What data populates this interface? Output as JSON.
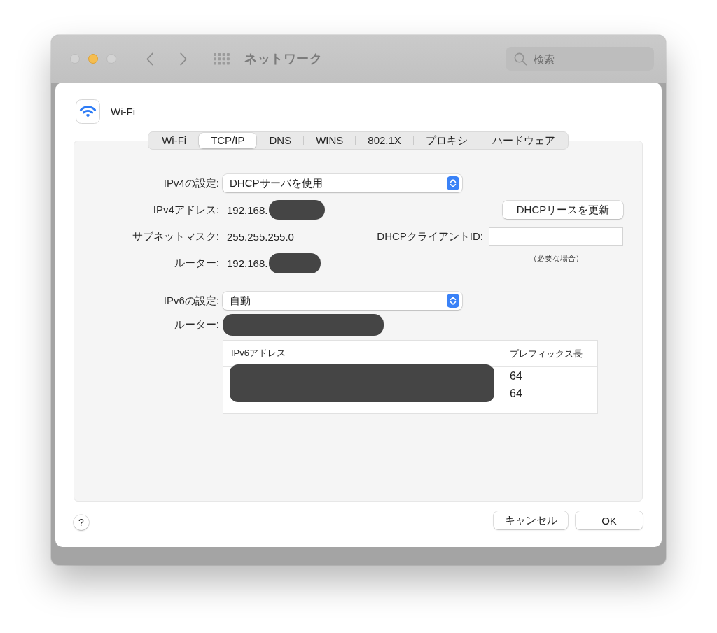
{
  "window": {
    "title": "ネットワーク",
    "search_placeholder": "検索"
  },
  "window_controls": [
    {
      "kind": "close",
      "disabled": true
    },
    {
      "kind": "minimize",
      "disabled": false
    },
    {
      "kind": "zoom",
      "disabled": true
    }
  ],
  "sheet": {
    "service_name": "Wi-Fi",
    "tabs": [
      {
        "label": "Wi-Fi",
        "selected": false
      },
      {
        "label": "TCP/IP",
        "selected": true
      },
      {
        "label": "DNS",
        "selected": false
      },
      {
        "label": "WINS",
        "selected": false
      },
      {
        "label": "802.1X",
        "selected": false
      },
      {
        "label": "プロキシ",
        "selected": false
      },
      {
        "label": "ハードウェア",
        "selected": false
      }
    ],
    "ipv4": {
      "config": {
        "label": "IPv4の設定:",
        "value": "DHCPサーバを使用"
      },
      "address": {
        "label": "IPv4アドレス:",
        "value": "192.168.",
        "redacted": true
      },
      "subnet_mask": {
        "label": "サブネットマスク:",
        "value": "255.255.255.0"
      },
      "router": {
        "label": "ルーター:",
        "value": "192.168.",
        "redacted": true
      },
      "renew_button": "DHCPリースを更新",
      "client_id": {
        "label": "DHCPクライアントID:",
        "note": "（必要な場合）"
      }
    },
    "ipv6": {
      "config": {
        "label": "IPv6の設定:",
        "value": "自動"
      },
      "router": {
        "label": "ルーター:",
        "redacted": true
      },
      "table": {
        "columns": [
          "IPv6アドレス",
          "プレフィックス長"
        ],
        "addresses_redacted": true,
        "rows": [
          {
            "prefix_length": "64"
          },
          {
            "prefix_length": "64"
          }
        ]
      }
    },
    "help_button": "?",
    "buttons": [
      "キャンセル",
      "OK"
    ]
  }
}
